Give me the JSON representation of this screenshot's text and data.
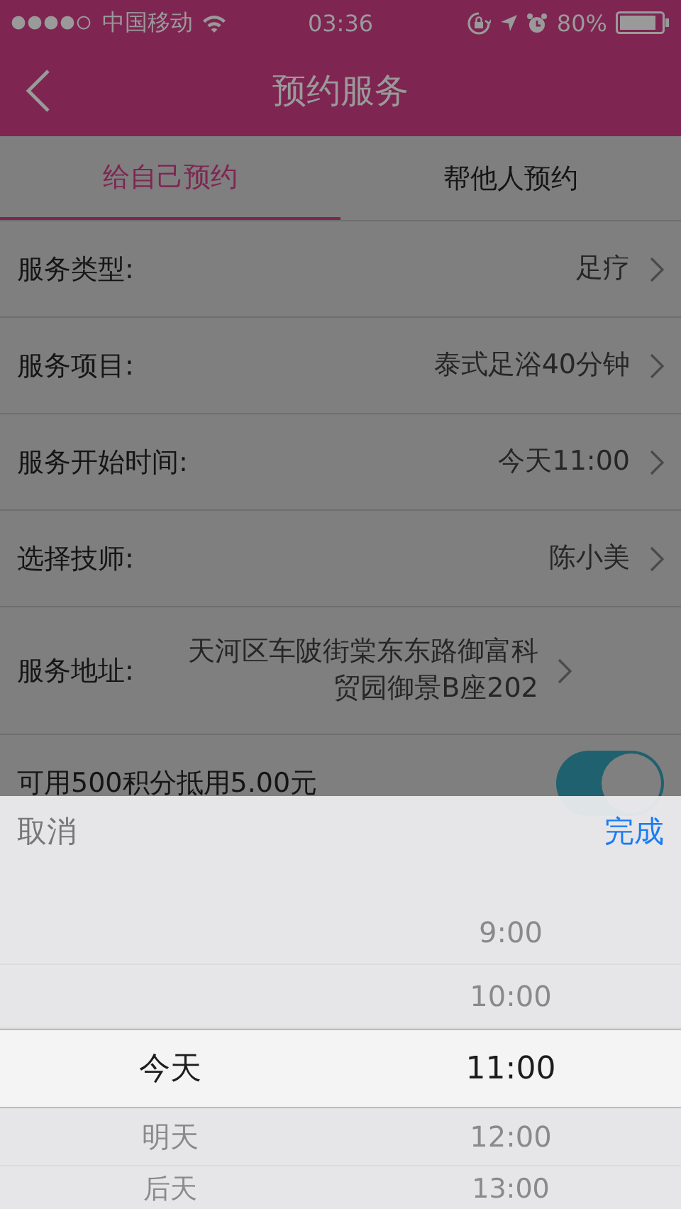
{
  "status_bar": {
    "carrier": "中国移动",
    "time": "03:36",
    "battery": "80%"
  },
  "header": {
    "title": "预约服务"
  },
  "tabs": [
    {
      "label": "给自己预约",
      "selected": true
    },
    {
      "label": "帮他人预约",
      "selected": false
    }
  ],
  "rows": [
    {
      "label": "服务类型:",
      "value": "足疗"
    },
    {
      "label": "服务项目:",
      "value": "泰式足浴40分钟"
    },
    {
      "label": "服务开始时间:",
      "value": "今天11:00"
    },
    {
      "label": "选择技师:",
      "value": "陈小美"
    },
    {
      "label": "服务地址:",
      "value": "天河区车陂街棠东东路御富科贸园御景B座202"
    }
  ],
  "points": {
    "label": "可用500积分抵用5.00元",
    "on": true
  },
  "picker": {
    "cancel": "取消",
    "done": "完成",
    "rows": [
      {
        "time": "9:00",
        "selected": false
      },
      {
        "time": "10:00",
        "selected": false
      },
      {
        "day": "今天",
        "time": "11:00",
        "selected": true
      },
      {
        "day": "明天",
        "time": "12:00",
        "selected": false
      },
      {
        "day": "后天",
        "time": "13:00",
        "selected": false
      }
    ]
  }
}
